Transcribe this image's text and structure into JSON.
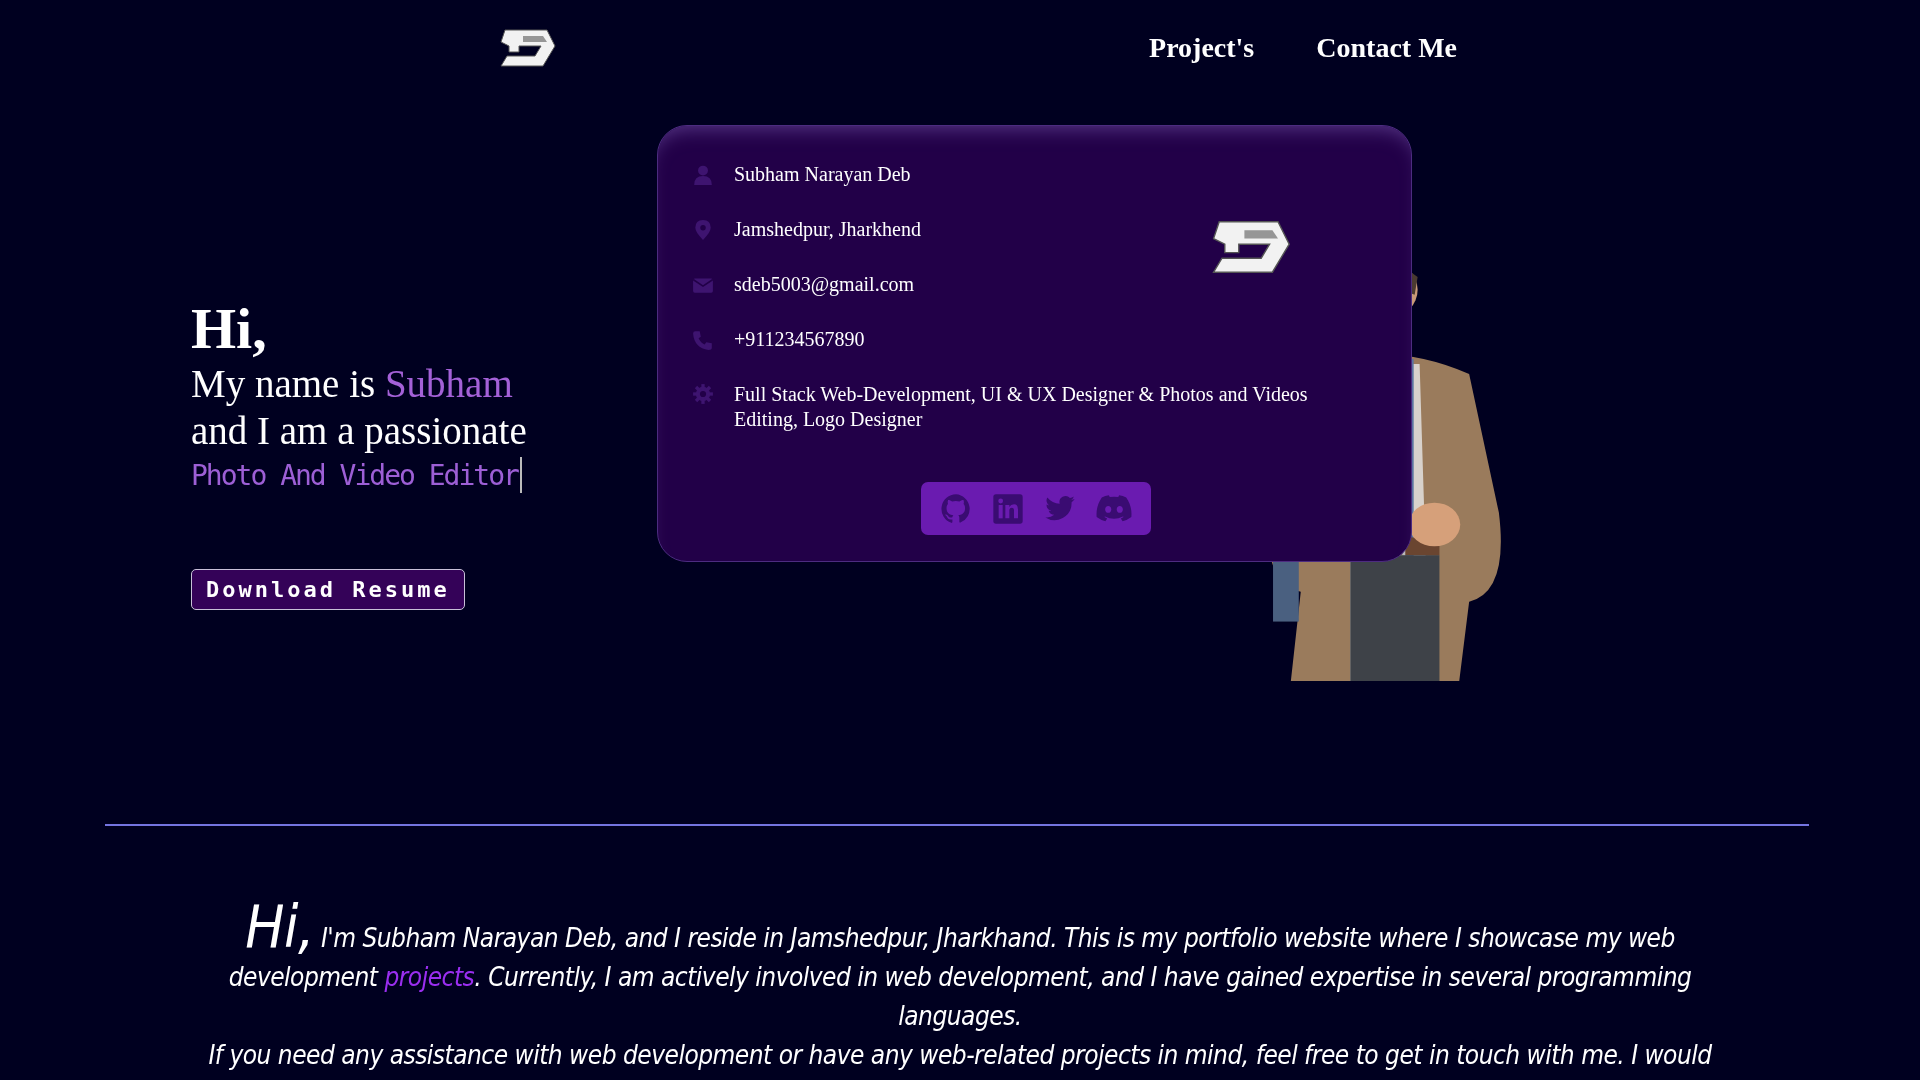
{
  "nav": {
    "links": [
      {
        "label": "Project's"
      },
      {
        "label": "Contact Me"
      }
    ]
  },
  "hero": {
    "greeting": "Hi,",
    "intro": "My name is ",
    "name": "Subham",
    "line": "and I am a passionate",
    "role": "Photo And Video Editor",
    "button": "Download Resume"
  },
  "card": {
    "rows": [
      {
        "kind": "person",
        "text": "Subham Narayan Deb"
      },
      {
        "kind": "location",
        "text": "Jamshedpur, Jharkhend"
      },
      {
        "kind": "email",
        "text": "sdeb5003@gmail.com"
      },
      {
        "kind": "phone",
        "text": "+911234567890"
      },
      {
        "kind": "skills",
        "text": "Full Stack Web-Development, UI & UX Designer & Photos and Videos Editing, Logo Designer"
      }
    ],
    "socials": [
      {
        "kind": "github"
      },
      {
        "kind": "linkedin"
      },
      {
        "kind": "twitter"
      },
      {
        "kind": "discord"
      }
    ]
  },
  "about": {
    "greeting": "Hi,",
    "before": "I'm Subham Narayan Deb, and I reside in Jamshedpur, Jharkhand. This is my portfolio website where I showcase my web development ",
    "link": "projects",
    "after": ". Currently, I am actively involved in web development, and I have gained expertise in several programming languages.",
    "second": "If you need any assistance with web development or have any web-related projects in mind, feel free to get in touch with me. I would"
  }
}
